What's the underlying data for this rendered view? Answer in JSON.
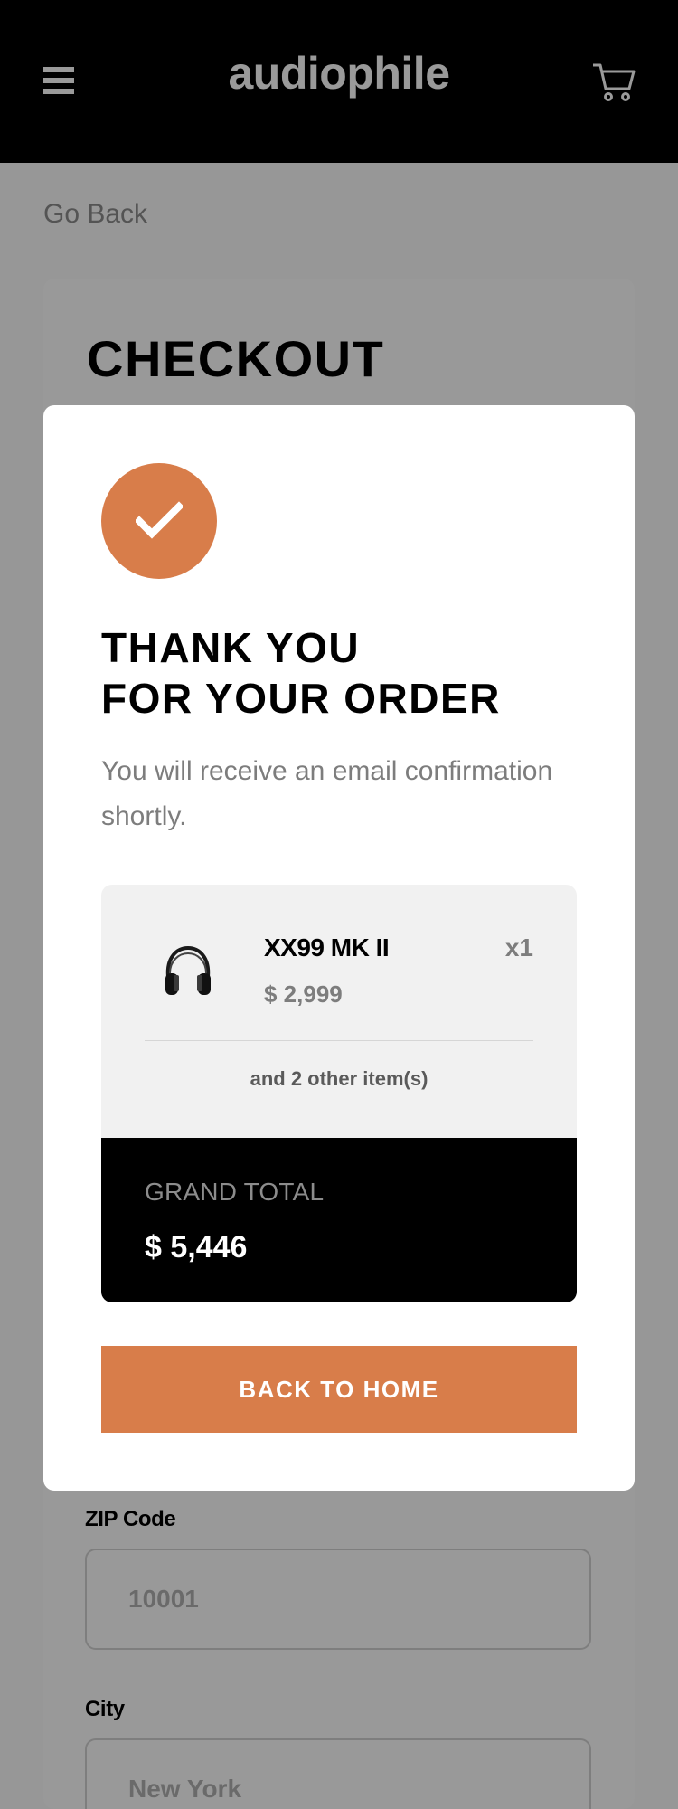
{
  "header": {
    "logo": "audiophile",
    "menu_icon": "hamburger-menu-icon",
    "cart_icon": "cart-icon"
  },
  "page": {
    "go_back": "Go Back",
    "checkout_title": "CHECKOUT"
  },
  "form": {
    "zip_label": "ZIP Code",
    "zip_placeholder": "10001",
    "city_label": "City",
    "city_placeholder": "New York"
  },
  "modal": {
    "success_icon": "checkmark-icon",
    "title_line1": "THANK YOU",
    "title_line2": "FOR YOUR ORDER",
    "message": "You will receive an email confirmation shortly.",
    "item": {
      "name": "XX99 MK II",
      "price": "$ 2,999",
      "quantity": "x1",
      "image": "headphones-icon"
    },
    "other_items": "and 2 other item(s)",
    "grand_total_label": "GRAND TOTAL",
    "grand_total_value": "$ 5,446",
    "back_button": "BACK TO HOME"
  },
  "colors": {
    "accent": "#d87d4a",
    "overlay": "#979797",
    "header": "#000000"
  }
}
